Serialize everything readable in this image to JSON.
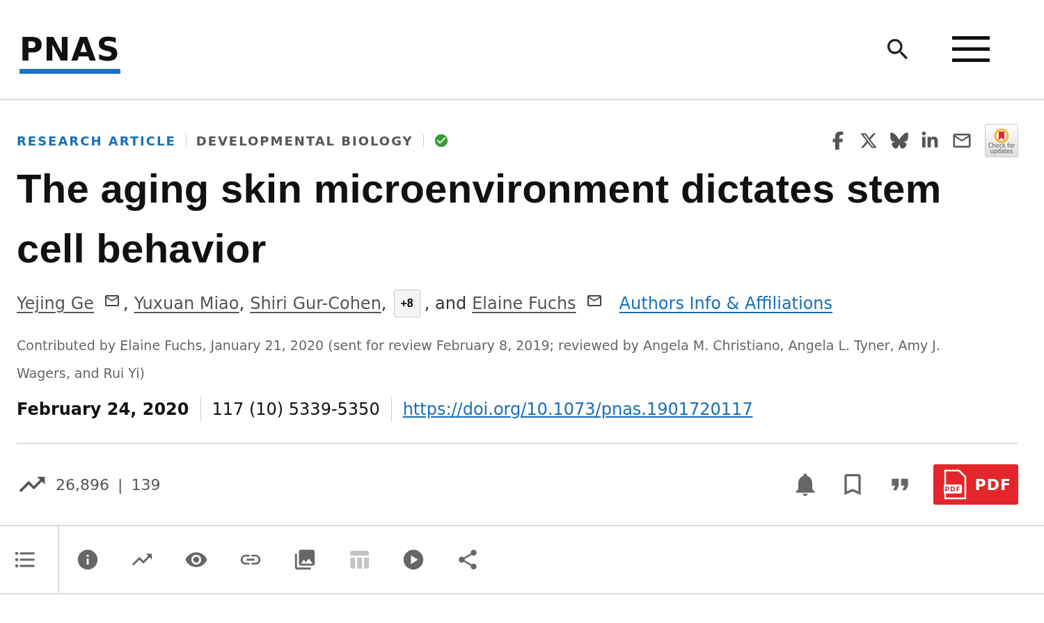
{
  "header": {
    "logo": "PNAS"
  },
  "article": {
    "type": "RESEARCH ARTICLE",
    "subject": "DEVELOPMENTAL BIOLOGY",
    "verified": true,
    "share": [
      {
        "kind": "facebook"
      },
      {
        "kind": "x"
      },
      {
        "kind": "bluesky"
      },
      {
        "kind": "linkedin"
      },
      {
        "kind": "email"
      }
    ],
    "updates_badge": "Check for updates",
    "title": "The aging skin microenvironment dictates stem cell behavior",
    "authors": [
      {
        "name": "Yejing Ge",
        "email": true,
        "sep": ","
      },
      {
        "name": "Yuxuan Miao",
        "email": false,
        "sep": ","
      },
      {
        "name": "Shiri Gur-Cohen",
        "email": false,
        "sep": ","
      }
    ],
    "more_authors": "+8",
    "and_text": ", and",
    "last_author": {
      "name": "Elaine Fuchs",
      "email": true
    },
    "affiliations_link": "Authors Info & Affiliations",
    "contributed": "Contributed by Elaine Fuchs, January 21, 2020 (sent for review February 8, 2019; reviewed by Angela M. Christiano, Angela L. Tyner, Amy J. Wagers, and Rui Yi)",
    "date": "February 24, 2020",
    "citation": "117 (10) 5339-5350",
    "doi": "https://doi.org/10.1073/pnas.1901720117"
  },
  "metrics": {
    "views": "26,896",
    "separator": "|",
    "citations": "139"
  },
  "actions": {
    "pdf_icon_text": "PDF",
    "pdf_label": "PDF"
  },
  "toolbar": [
    {
      "kind": "contents",
      "disabled": false
    },
    {
      "kind": "info",
      "disabled": false
    },
    {
      "kind": "metrics",
      "disabled": false
    },
    {
      "kind": "view",
      "disabled": false
    },
    {
      "kind": "link",
      "disabled": false
    },
    {
      "kind": "figures",
      "disabled": false
    },
    {
      "kind": "tables",
      "disabled": true
    },
    {
      "kind": "media",
      "disabled": false
    },
    {
      "kind": "share",
      "disabled": false
    }
  ]
}
